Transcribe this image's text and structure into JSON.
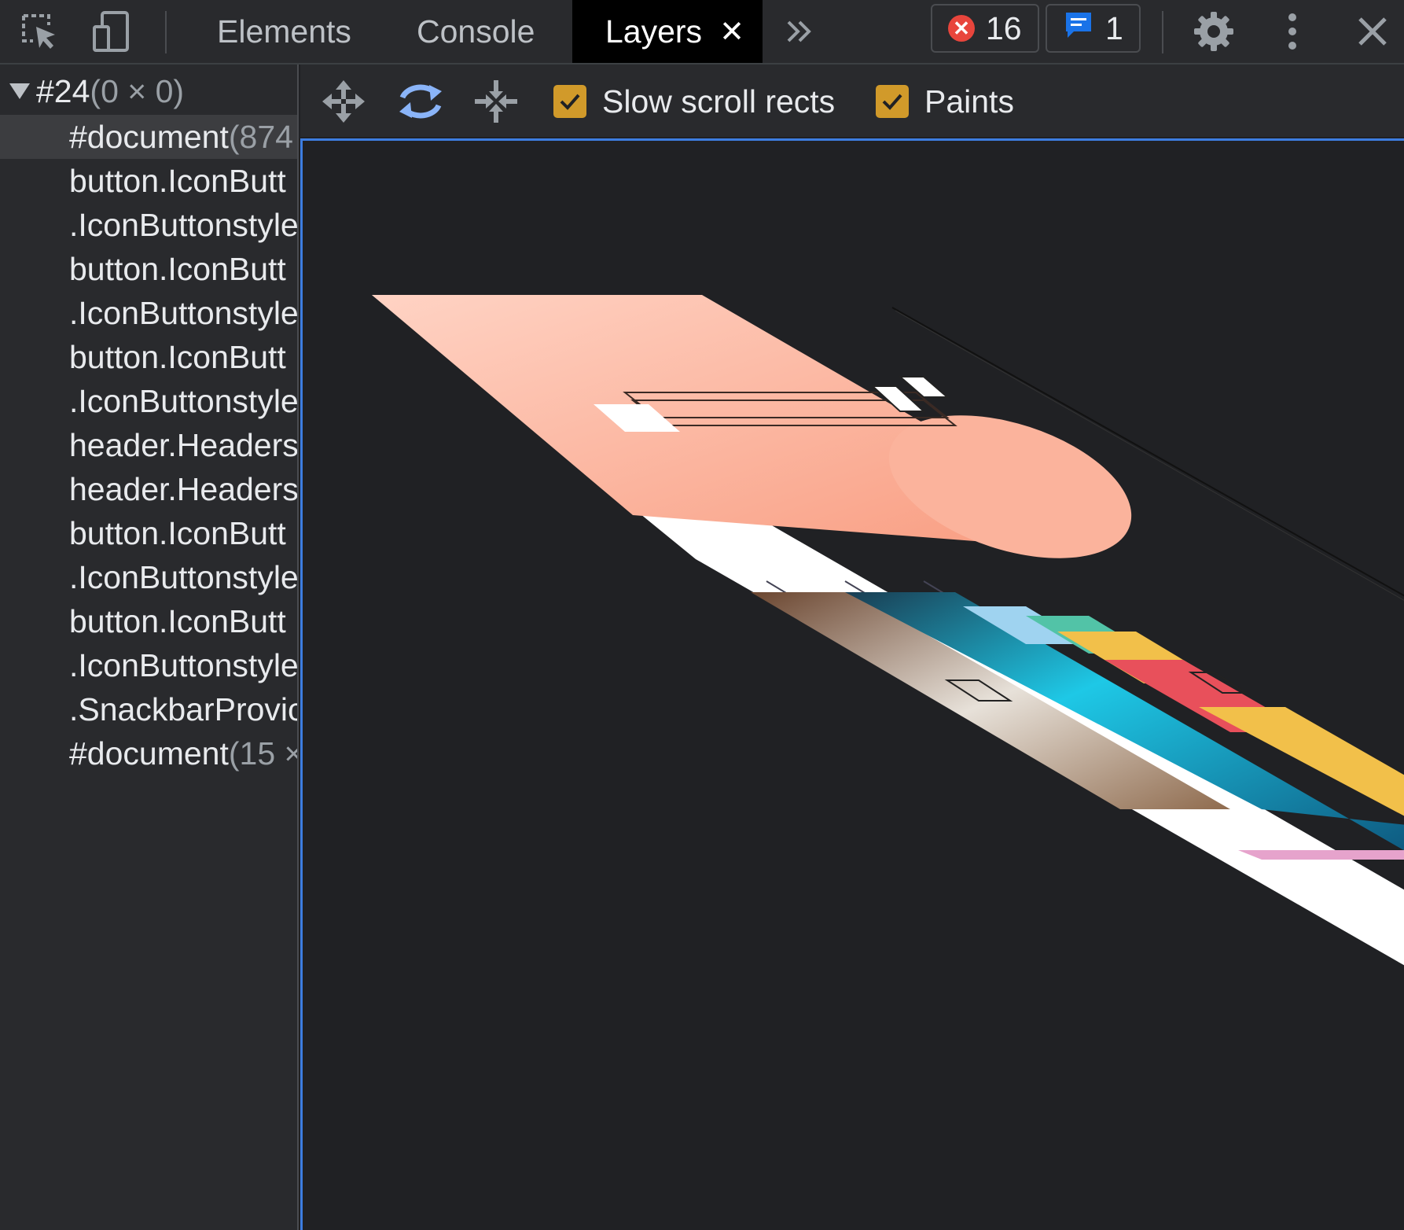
{
  "toolbar": {
    "tabs": [
      {
        "label": "Elements"
      },
      {
        "label": "Console"
      },
      {
        "label": "Layers",
        "close_icon": "close-icon"
      }
    ],
    "more_tabs_icon": "chevron-double-right-icon",
    "errors_count": "16",
    "messages_count": "1",
    "settings_icon": "gear-icon",
    "menu_icon": "kebab-menu-icon",
    "close_icon": "close-devtools-icon"
  },
  "layer_tree": {
    "root": {
      "name": "#24",
      "size": "(0 × 0)"
    },
    "items": [
      {
        "name": "#document",
        "size": "(874"
      },
      {
        "name": "button.IconButt",
        "size": ""
      },
      {
        "name": ".IconButtonstyle",
        "size": ""
      },
      {
        "name": "button.IconButt",
        "size": ""
      },
      {
        "name": ".IconButtonstyle",
        "size": ""
      },
      {
        "name": "button.IconButt",
        "size": ""
      },
      {
        "name": ".IconButtonstyle",
        "size": ""
      },
      {
        "name": "header.Headers",
        "size": ""
      },
      {
        "name": "header.Headers",
        "size": ""
      },
      {
        "name": "button.IconButt",
        "size": ""
      },
      {
        "name": ".IconButtonstyle",
        "size": ""
      },
      {
        "name": "button.IconButt",
        "size": ""
      },
      {
        "name": ".IconButtonstyle",
        "size": ""
      },
      {
        "name": ".SnackbarProvic",
        "size": ""
      },
      {
        "name": "#document",
        "size": "(15 ×"
      }
    ]
  },
  "layers_toolbar": {
    "pan_icon": "pan-mode-icon",
    "rotate_icon": "rotate-mode-icon",
    "reset_icon": "reset-transform-icon",
    "slow_scroll_label": "Slow scroll rects",
    "slow_scroll_checked": true,
    "paints_label": "Paints",
    "paints_checked": true
  },
  "colors": {
    "accent": "#3d7de0",
    "checkbox": "#d19a2a",
    "error": "#e8453c",
    "message": "#1a73e8",
    "panel_bg": "#292a2d",
    "viewport_bg": "#202124"
  }
}
